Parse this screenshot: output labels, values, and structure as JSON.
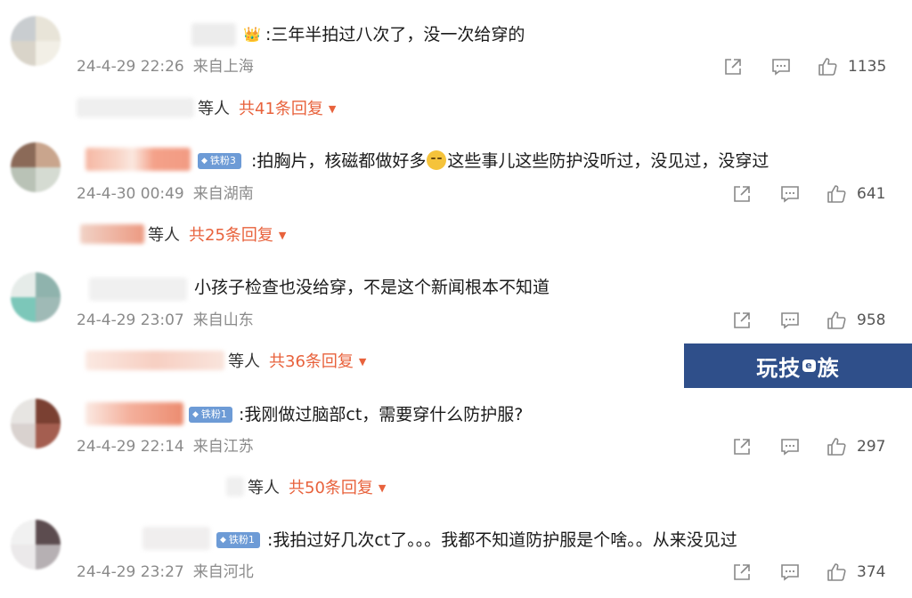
{
  "comments": [
    {
      "text": ":三年半拍过八次了，没一次给穿的",
      "date": "24-4-29 22:26",
      "location": "来自上海",
      "likes": "1135",
      "replies": {
        "who": "等人",
        "count": "共41条回复"
      }
    },
    {
      "badge": "铁粉3",
      "text_before": ":拍胸片，核磁都做好多",
      "text_after": "这些事儿这些防护没听过，没见过，没穿过",
      "date": "24-4-30 00:49",
      "location": "来自湖南",
      "likes": "641",
      "replies": {
        "who": "等人",
        "count": "共25条回复"
      }
    },
    {
      "text": "小孩子检查也没给穿，不是这个新闻根本不知道",
      "date": "24-4-29 23:07",
      "location": "来自山东",
      "likes": "958",
      "replies": {
        "who": "等人",
        "count": "共36条回复"
      }
    },
    {
      "badge": "铁粉1",
      "text": ":我刚做过脑部ct，需要穿什么防护服?",
      "date": "24-4-29 22:14",
      "location": "来自江苏",
      "likes": "297",
      "replies": {
        "who": "等人",
        "count": "共50条回复"
      }
    },
    {
      "badge": "铁粉1",
      "text": ":我拍过好几次ct了。。。我都不知道防护服是个啥。。从来没见过",
      "date": "24-4-29 23:27",
      "location": "来自河北",
      "likes": "374"
    }
  ],
  "icons": {
    "share": "share-icon",
    "comment": "comment-icon",
    "like": "thumbs-up-icon",
    "caret": "caret-down-icon"
  },
  "colors": {
    "reply_count": "#e8623c",
    "badge": "#6d9bd6",
    "meta": "#8a8a8a",
    "watermark_bg": "#2f4f8a"
  },
  "watermark": {
    "left": "玩技",
    "mid": "e",
    "right": "族"
  }
}
